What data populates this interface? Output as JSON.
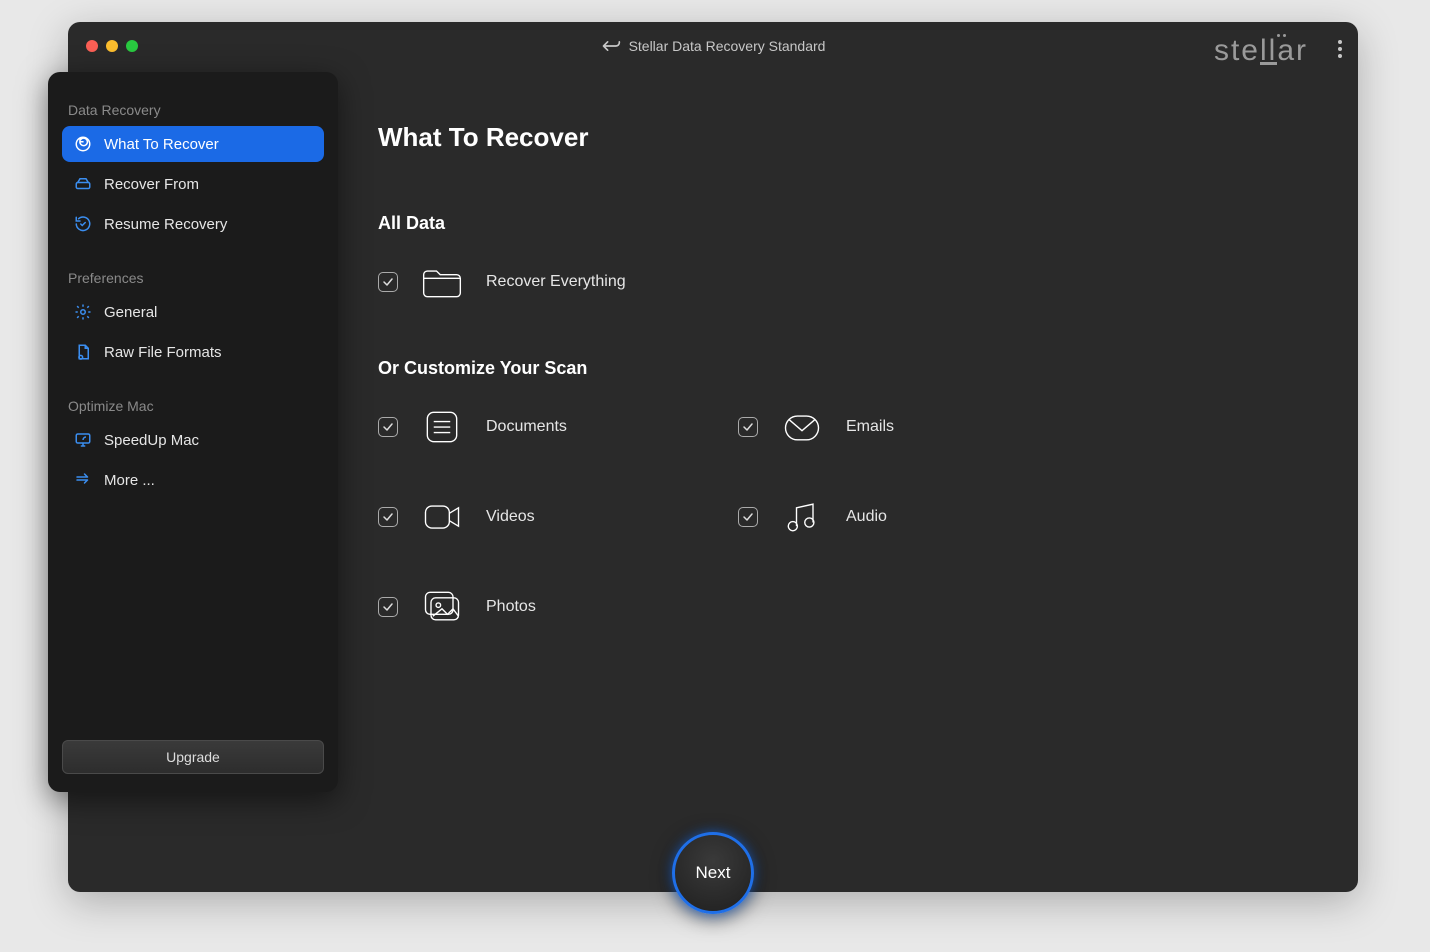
{
  "titlebar": {
    "window_title": "Stellar Data Recovery Standard",
    "brand": "stellar"
  },
  "sidebar": {
    "sections": [
      {
        "title": "Data Recovery",
        "items": [
          {
            "label": "What To Recover",
            "icon": "recovery-circle-icon",
            "active": true
          },
          {
            "label": "Recover From",
            "icon": "drive-icon",
            "active": false
          },
          {
            "label": "Resume Recovery",
            "icon": "resume-check-icon",
            "active": false
          }
        ]
      },
      {
        "title": "Preferences",
        "items": [
          {
            "label": "General",
            "icon": "gear-icon",
            "active": false
          },
          {
            "label": "Raw File Formats",
            "icon": "file-raw-icon",
            "active": false
          }
        ]
      },
      {
        "title": "Optimize Mac",
        "items": [
          {
            "label": "SpeedUp Mac",
            "icon": "monitor-speed-icon",
            "active": false
          },
          {
            "label": "More ...",
            "icon": "more-arrows-icon",
            "active": false
          }
        ]
      }
    ],
    "upgrade_label": "Upgrade"
  },
  "main": {
    "page_title": "What To Recover",
    "all_data_heading": "All Data",
    "all_option": {
      "label": "Recover Everything",
      "checked": true,
      "icon": "folder-icon"
    },
    "customize_heading": "Or Customize Your Scan",
    "options": [
      {
        "label": "Documents",
        "checked": true,
        "icon": "documents-icon"
      },
      {
        "label": "Emails",
        "checked": true,
        "icon": "emails-icon"
      },
      {
        "label": "Videos",
        "checked": true,
        "icon": "videos-icon"
      },
      {
        "label": "Audio",
        "checked": true,
        "icon": "audio-icon"
      },
      {
        "label": "Photos",
        "checked": true,
        "icon": "photos-icon"
      }
    ],
    "next_label": "Next"
  }
}
